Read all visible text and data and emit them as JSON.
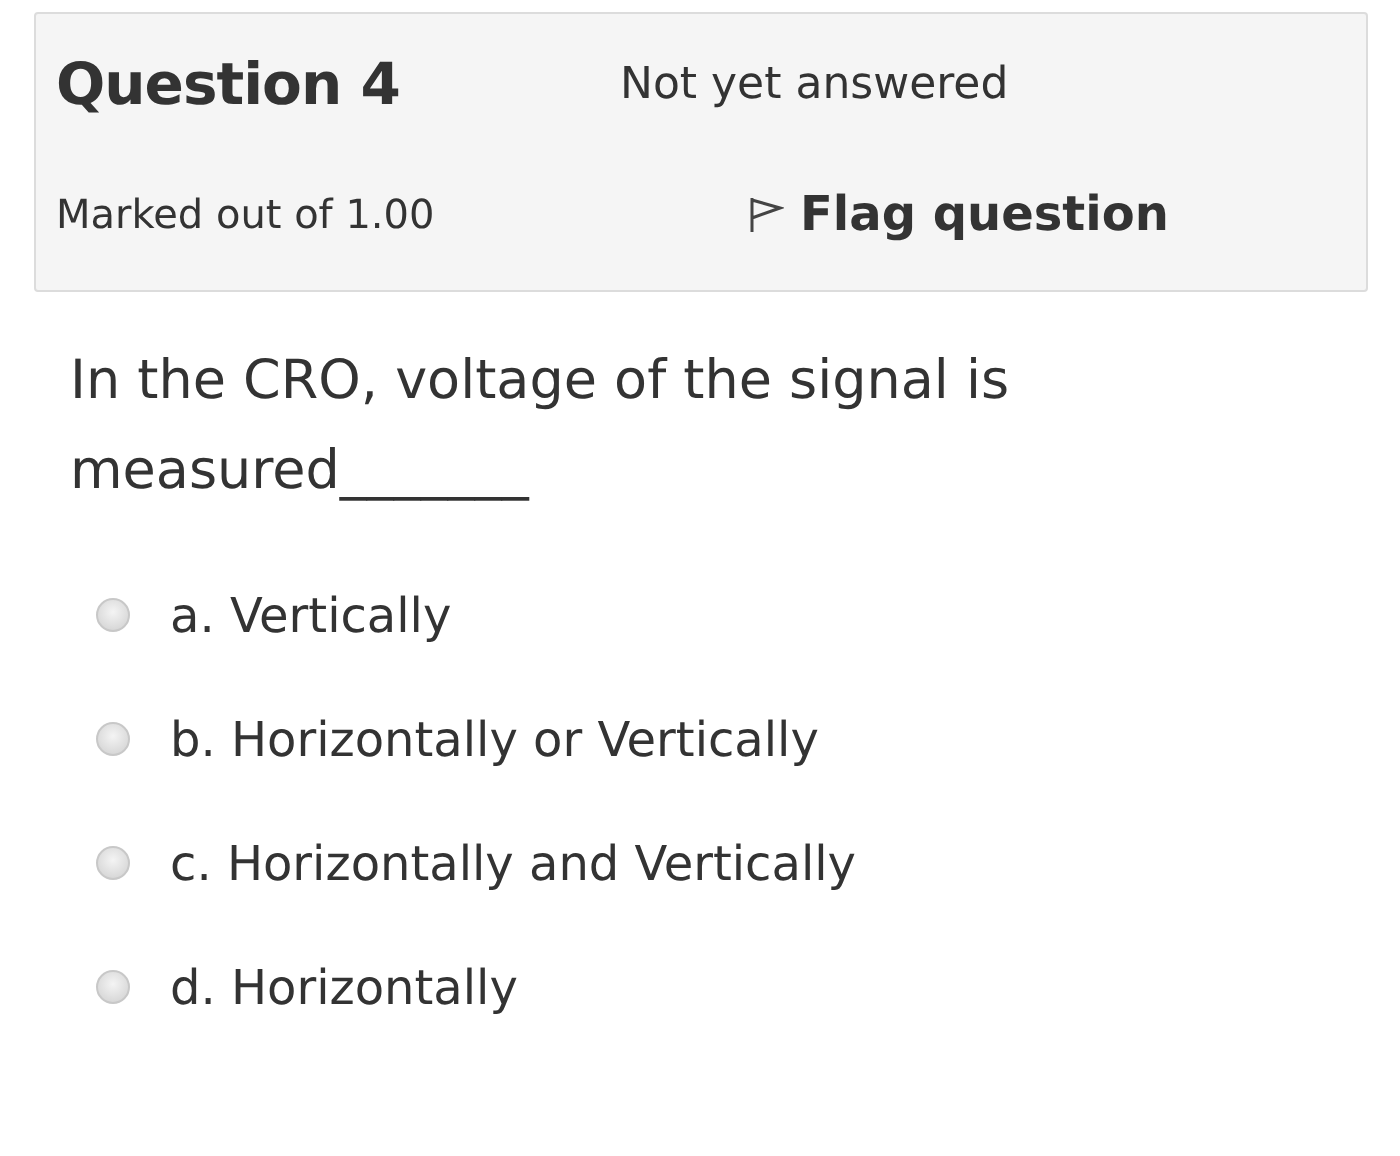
{
  "info": {
    "title": "Question 4",
    "state": "Not yet answered",
    "grade": "Marked out of 1.00",
    "flag": {
      "label": "Flag question",
      "flagged": false
    }
  },
  "question": {
    "text": "In the CRO, voltage of the signal is measured_______"
  },
  "options": [
    {
      "label": "a. Vertically",
      "selected": false
    },
    {
      "label": "b. Horizontally or Vertically",
      "selected": false
    },
    {
      "label": "c. Horizontally and Vertically",
      "selected": false
    },
    {
      "label": "d. Horizontally",
      "selected": false
    }
  ]
}
